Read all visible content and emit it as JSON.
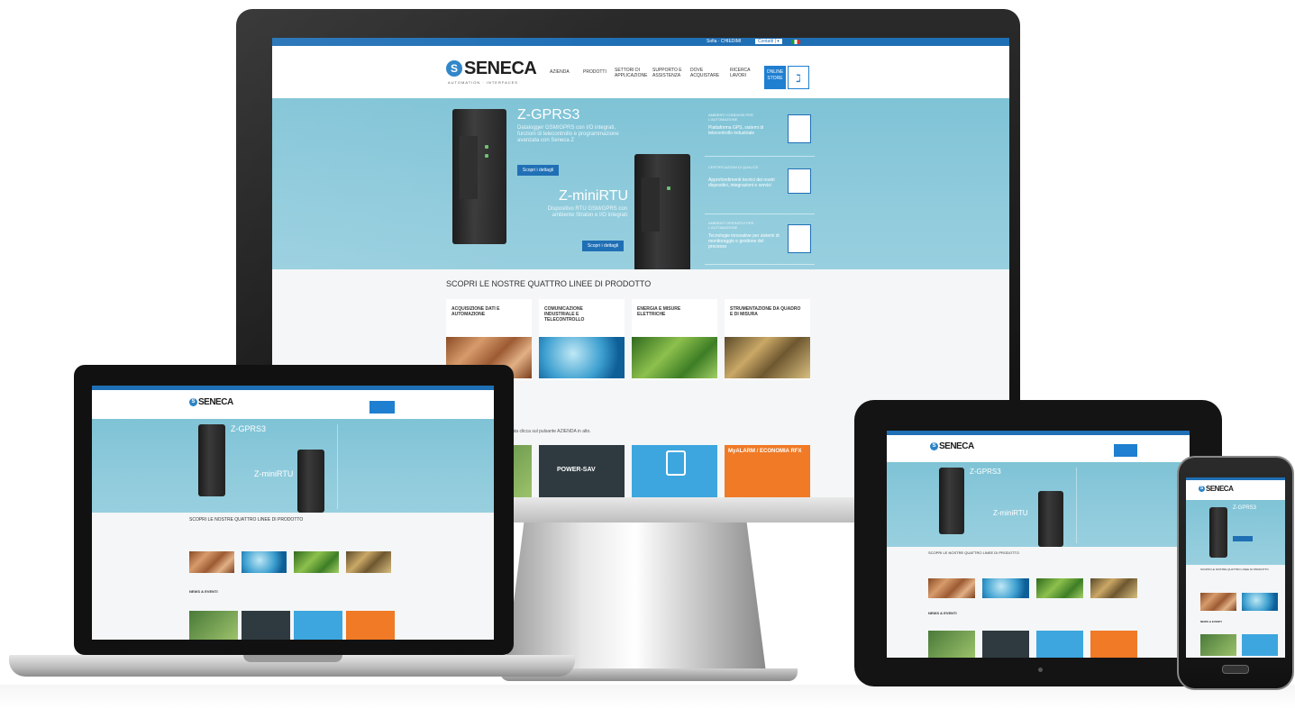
{
  "site": {
    "topbar_links": [
      "Sofia · CHIEDIMI",
      "Contatti | ▾"
    ],
    "logo_text": "SENECA",
    "logo_letter": "S",
    "logo_sub": "AUTOMATION · INTERFACES",
    "nav": [
      "AZIENDA",
      "PRODOTTI",
      "SETTORI DI APPLICAZIONE",
      "SUPPORTO E ASSISTENZA",
      "DOVE ACQUISTARE",
      "RICERCA LAVORI"
    ],
    "nav_button": "ONLINE STORE",
    "hero": {
      "title1": "Z-GPRS3",
      "text1": "Datalogger GSM/GPRS con I/O integrati, funzioni di telecontrollo e programmazione avanzata con Seneca Z",
      "btn1": "Scopri i dettagli",
      "title2": "Z-miniRTU",
      "text2": "Dispositivo RTU GSM/GPRS con ambiente Straton e I/O integrati",
      "btn2": "Scopri i dettagli"
    },
    "certs": [
      {
        "head": "AMBIENTI CONDIVISI PER L'AUTOMAZIONE",
        "body": "Piattaforma GPS, sistemi di telecontrollo industriale"
      },
      {
        "head": "CERTIFICAZIONI DI QUALITÀ",
        "body": "Approfondimenti tecnici dei nostri dispositivi, integrazioni e servizi"
      },
      {
        "head": "AMBIENTI OPERATIVI PER L'AUTOMAZIONE",
        "body": "Tecnologie innovative per sistemi di monitoraggio e gestione del processo"
      }
    ],
    "lines_title": "SCOPRI LE NOSTRE QUATTRO LINEE DI PRODOTTO",
    "lines": [
      "ACQUISIZIONE DATI E AUTOMAZIONE",
      "COMUNICAZIONE INDUSTRIALE E TELECONTROLLO",
      "ENERGIA E MISURE ELETTRICHE",
      "STRUMENTAZIONE DA QUADRO E DI MISURA"
    ],
    "news_title": "NEWS & EVENTI",
    "news_text": "Per raggiungere la sezione dedicata clicca sul pulsante AZIENDA in alto.",
    "news_items": [
      "POWER-SAV",
      "",
      "MyALARM / ECONOMIA RFX"
    ]
  },
  "colors": {
    "brand_blue": "#1f6fb5",
    "hero_bg": "#8fcbdc",
    "page_bg": "#f4f6f7"
  }
}
